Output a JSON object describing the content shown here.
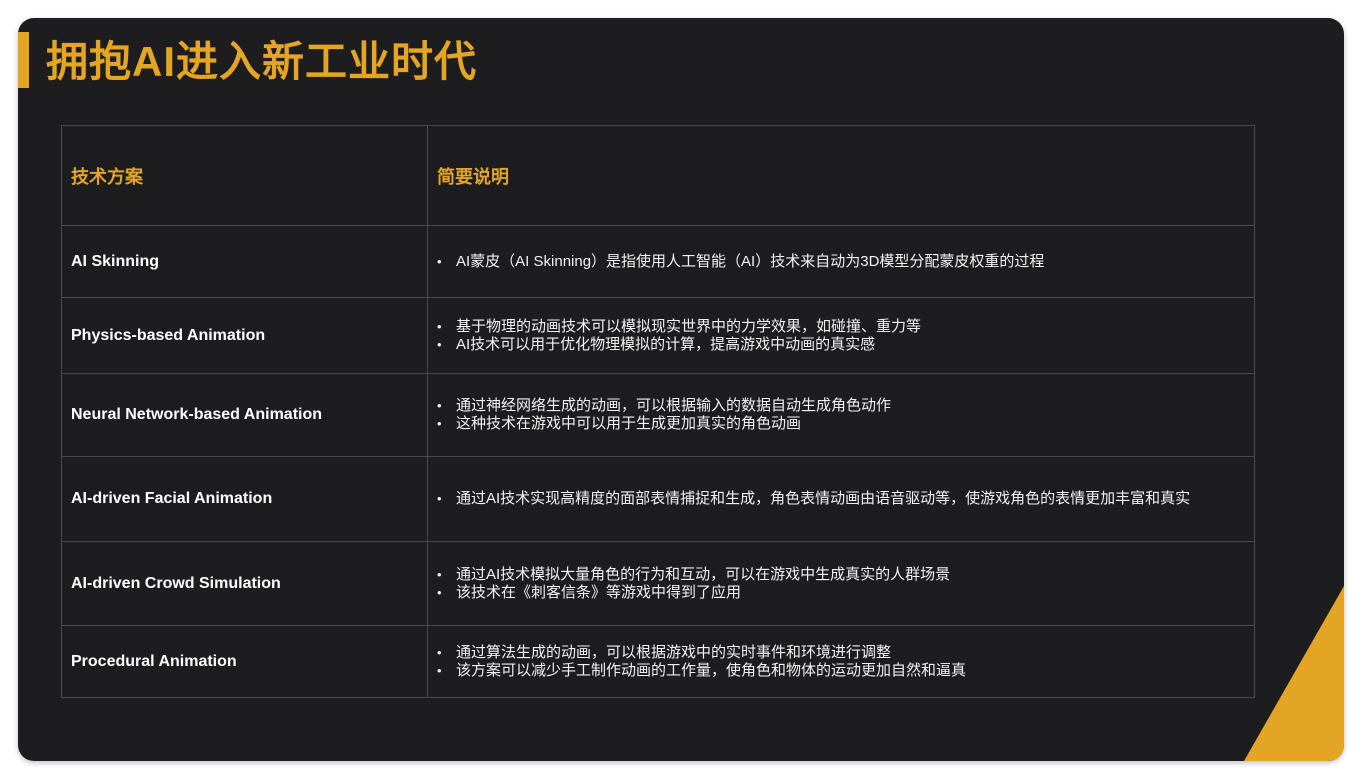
{
  "slide": {
    "title": "拥抱AI进入新工业时代",
    "accent_color": "#e5a524",
    "background_color": "#1d1d1f"
  },
  "table": {
    "headers": [
      "技术方案",
      "简要说明"
    ],
    "rows": [
      {
        "name": "AI Skinning",
        "bullets": [
          "AI蒙皮（AI Skinning）是指使用人工智能（AI）技术来自动为3D模型分配蒙皮权重的过程"
        ]
      },
      {
        "name": "Physics-based Animation",
        "bullets": [
          "基于物理的动画技术可以模拟现实世界中的力学效果，如碰撞、重力等",
          "AI技术可以用于优化物理模拟的计算，提高游戏中动画的真实感"
        ]
      },
      {
        "name": "Neural Network-based Animation",
        "bullets": [
          "通过神经网络生成的动画，可以根据输入的数据自动生成角色动作",
          "这种技术在游戏中可以用于生成更加真实的角色动画"
        ]
      },
      {
        "name": "AI-driven Facial Animation",
        "bullets": [
          "通过AI技术实现高精度的面部表情捕捉和生成，角色表情动画由语音驱动等，使游戏角色的表情更加丰富和真实"
        ]
      },
      {
        "name": "AI-driven Crowd Simulation",
        "bullets": [
          "通过AI技术模拟大量角色的行为和互动，可以在游戏中生成真实的人群场景",
          "该技术在《刺客信条》等游戏中得到了应用"
        ]
      },
      {
        "name": "Procedural Animation",
        "bullets": [
          "通过算法生成的动画，可以根据游戏中的实时事件和环境进行调整",
          "该方案可以减少手工制作动画的工作量，使角色和物体的运动更加自然和逼真"
        ]
      }
    ]
  }
}
